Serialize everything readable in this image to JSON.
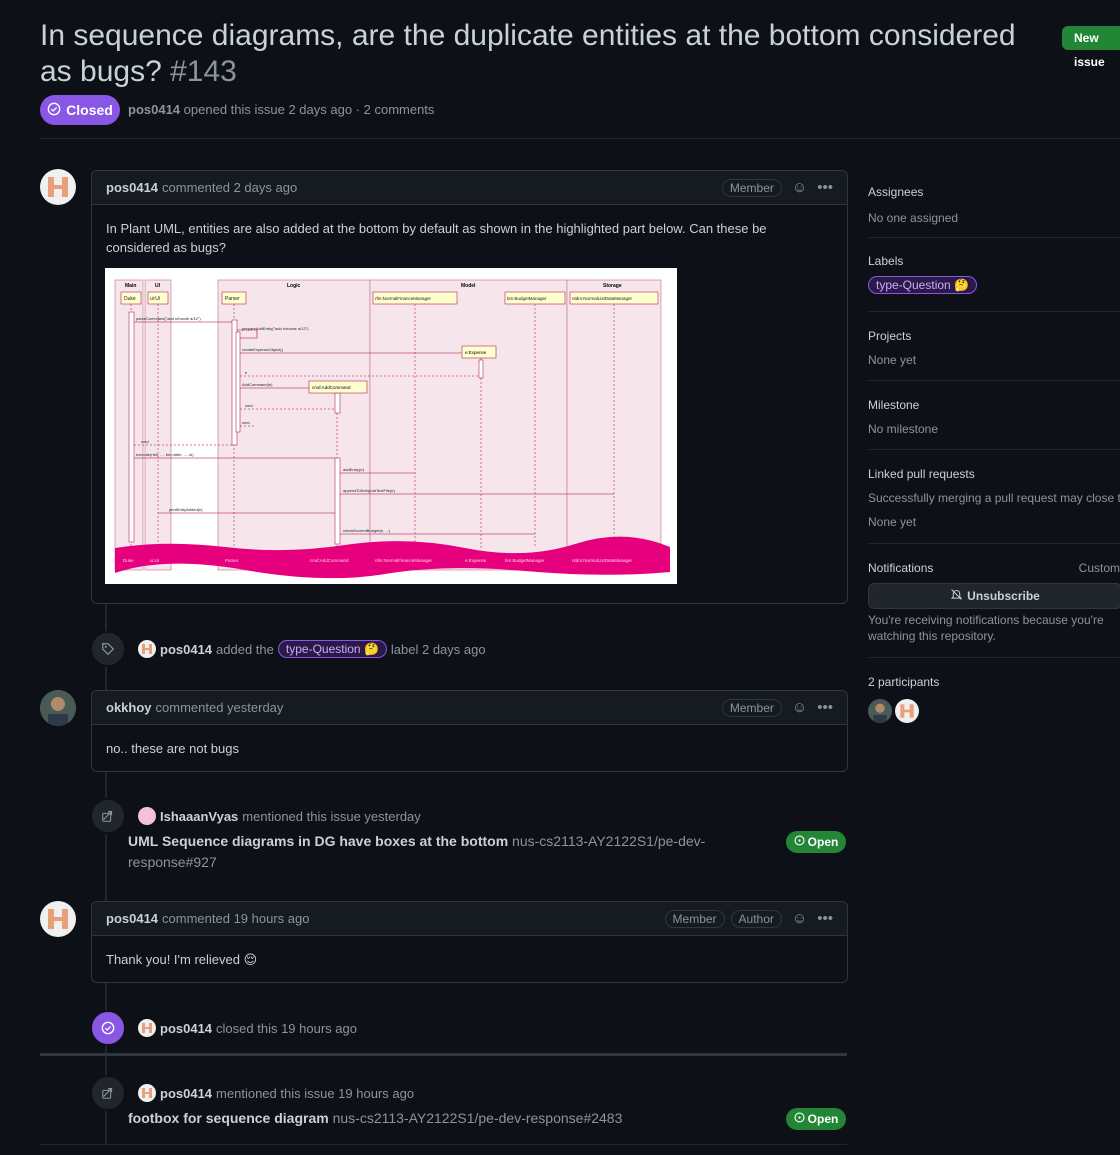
{
  "header": {
    "title": "In sequence diagrams, are the duplicate entities at the bottom considered as bugs?",
    "number": "#143",
    "new_issue_label": "New issue",
    "state": "Closed",
    "author": "pos0414",
    "meta_text": "opened this issue 2 days ago · 2 comments"
  },
  "comments": [
    {
      "author": "pos0414",
      "time": "commented 2 days ago",
      "roles": [
        "Member"
      ],
      "body": "In Plant UML, entities are also added at the bottom by default as shown in the highlighted part below. Can these be considered as bugs?"
    },
    {
      "author": "okkhoy",
      "time": "commented yesterday",
      "roles": [
        "Member"
      ],
      "body": "no.. these are not bugs"
    },
    {
      "author": "pos0414",
      "time": "commented 19 hours ago",
      "roles": [
        "Member",
        "Author"
      ],
      "body": "Thank you! I'm relieved"
    }
  ],
  "events": {
    "label_added": {
      "actor": "pos0414",
      "pre": "added the",
      "label": "type-Question",
      "post": "label 2 days ago"
    },
    "mention1": {
      "actor": "IshaaanVyas",
      "text": "mentioned this issue yesterday",
      "ref_title": "UML Sequence diagrams in DG have boxes at the bottom",
      "ref_repo": "nus-cs2113-AY2122S1/pe-dev-response#927",
      "ref_state": "Open"
    },
    "closed": {
      "actor": "pos0414",
      "text": "closed this 19 hours ago"
    },
    "mention2": {
      "actor": "pos0414",
      "text": "mentioned this issue 19 hours ago",
      "ref_title": "footbox for sequence diagram",
      "ref_repo": "nus-cs2113-AY2122S1/pe-dev-response#2483",
      "ref_state": "Open"
    }
  },
  "sidebar": {
    "assignees_title": "Assignees",
    "assignees_value": "No one assigned",
    "labels_title": "Labels",
    "label": "type-Question",
    "projects_title": "Projects",
    "projects_value": "None yet",
    "milestone_title": "Milestone",
    "milestone_value": "No milestone",
    "linked_title": "Linked pull requests",
    "linked_desc": "Successfully merging a pull request may close this iss",
    "linked_value": "None yet",
    "notifications_title": "Notifications",
    "customize": "Custom",
    "unsubscribe_label": "Unsubscribe",
    "notif_desc": "You're receiving notifications because you're watching this repository.",
    "participants_title": "2 participants"
  },
  "diagram": {
    "boxes": [
      "Main",
      "UI",
      "Logic",
      "Model",
      "Storage"
    ],
    "participants": [
      "Duke",
      "ui:Ui",
      "Parser",
      "rfm:NormalFinanceManager",
      "bm:BudgetManager",
      "ntdm:NormalListDataManager"
    ],
    "messages": [
      "parseCommand(\"add n/movie a/12\")",
      "prepareAddEntry(\"add n/movie a/12\")",
      "createExpenseObject()",
      "e",
      "AddCommand(e)",
      "cmd",
      "cmd",
      "cmd",
      "execute(nfm, ..., bm,ntdm, ..., ui)",
      "addEntry(e)",
      "appendToEntryListTextFile(e)",
      "printEntryAdded(e)",
      "checkExceedBudget(e, ...)"
    ],
    "created": [
      "e:Expense",
      "cmd:AddCommand"
    ],
    "footer": [
      "Duke",
      "ui:Ui",
      "Parser",
      "cmd:AddCommand",
      "nfm:NormalFinanceManager",
      "e:Expense",
      "bm:BudgetManager",
      "ntdm:NormalListDataManager"
    ]
  },
  "colors": {
    "accent": "#8957e5",
    "open": "#238636",
    "highlight": "#e6007e"
  }
}
